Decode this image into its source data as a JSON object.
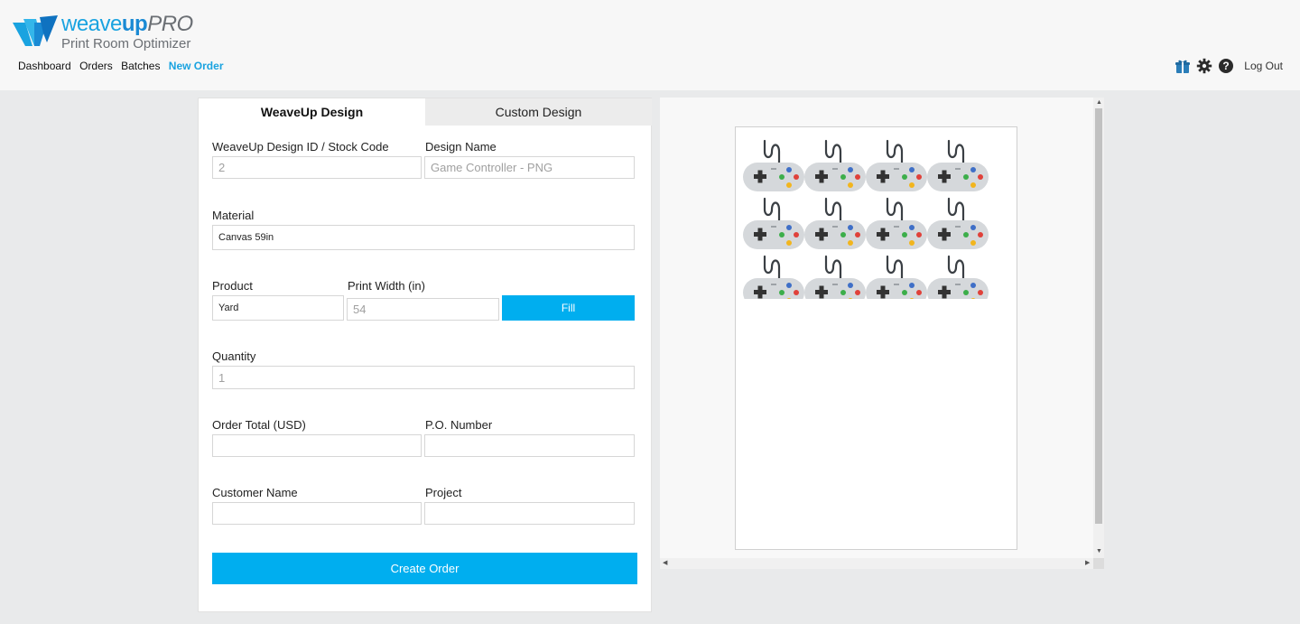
{
  "app": {
    "logo_prefix": "weave",
    "logo_bold": "up",
    "logo_suffix": "PRO",
    "logo_subtitle": "Print Room Optimizer"
  },
  "nav": {
    "items": [
      {
        "label": "Dashboard",
        "active": false
      },
      {
        "label": "Orders",
        "active": false
      },
      {
        "label": "Batches",
        "active": false
      },
      {
        "label": "New Order",
        "active": true
      }
    ]
  },
  "header_right": {
    "icons": [
      "gift-icon",
      "gear-icon",
      "help-icon"
    ],
    "logout_label": "Log Out"
  },
  "tabs": [
    {
      "label": "WeaveUp Design",
      "active": true
    },
    {
      "label": "Custom Design",
      "active": false
    }
  ],
  "form": {
    "design_id_label": "WeaveUp Design ID / Stock Code",
    "design_id_value": "2",
    "design_name_label": "Design Name",
    "design_name_value": "Game Controller - PNG",
    "material_label": "Material",
    "material_value": "Canvas 59in",
    "product_label": "Product",
    "product_value": "Yard",
    "print_width_label": "Print Width (in)",
    "print_width_value": "54",
    "fill_label": "Fill",
    "quantity_label": "Quantity",
    "quantity_value": "1",
    "order_total_label": "Order Total (USD)",
    "order_total_value": "",
    "po_label": "P.O. Number",
    "po_value": "",
    "customer_label": "Customer Name",
    "customer_value": "",
    "project_label": "Project",
    "project_value": "",
    "create_label": "Create Order"
  },
  "preview": {
    "pattern_rows": 3,
    "pattern_cols": 4,
    "colors": {
      "accent": "#00aeef",
      "controller_body": "#d5d8db",
      "dpad": "#333333",
      "cord": "#3a3f44",
      "btn_blue": "#3f6fc7",
      "btn_red": "#e0413a",
      "btn_green": "#3cae4a",
      "btn_yellow": "#f2b51d"
    }
  }
}
